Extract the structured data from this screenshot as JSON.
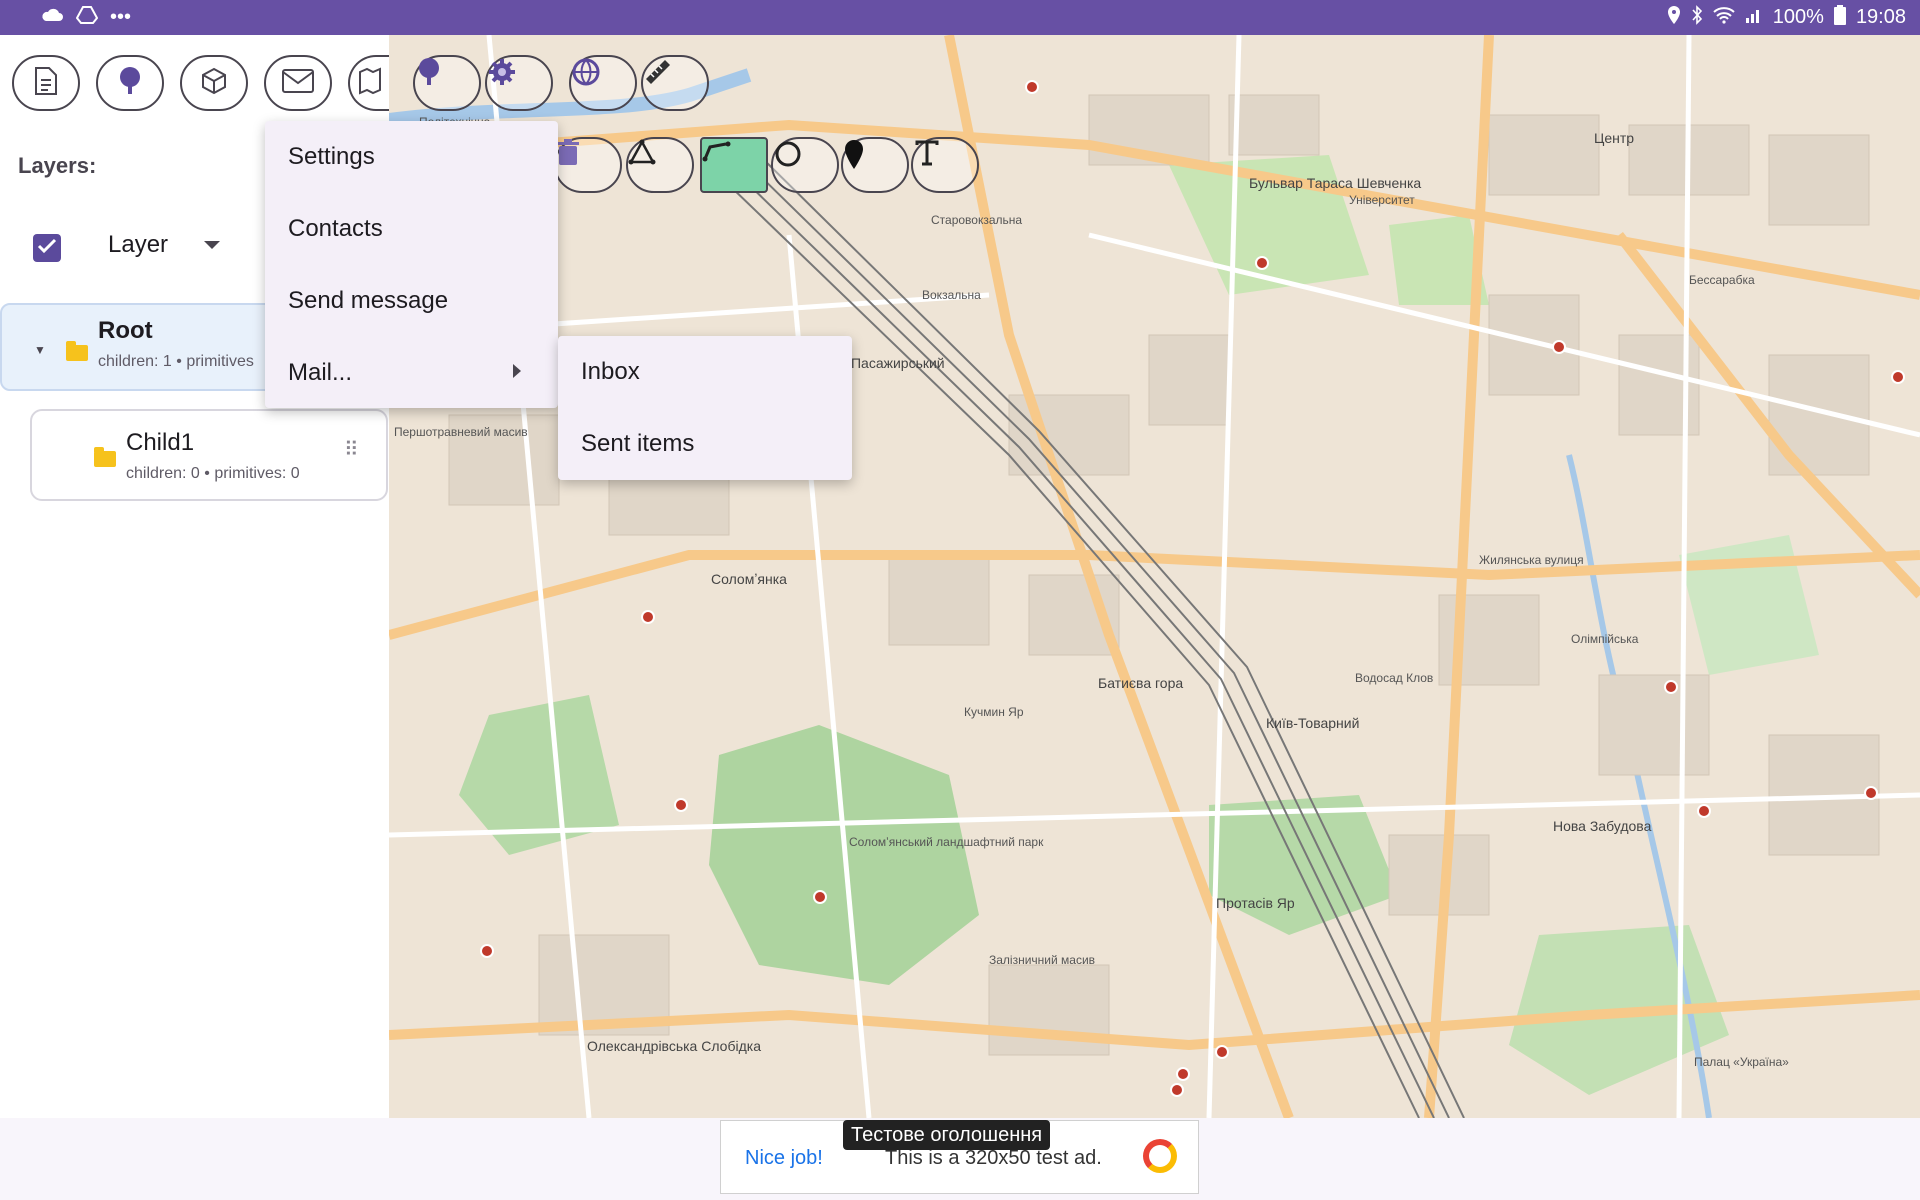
{
  "status_bar": {
    "left_icons": [
      "cloud-icon",
      "drive-icon",
      "more-icon"
    ],
    "battery": "100%",
    "time": "19:08",
    "more_glyph": "•••",
    "color": "#6750a4"
  },
  "panel": {
    "toolbar_icons": [
      "document-icon",
      "tree-icon",
      "cube-icon",
      "mail-icon",
      "map-pin-icon"
    ],
    "layers_title": "Layers:",
    "layer_checkbox_checked": true,
    "layer_select_value": "Layer",
    "tree": {
      "root": {
        "name": "Root",
        "sub": "children: 1 • primitives"
      },
      "child": {
        "name": "Child1",
        "sub": "children: 0 • primitives: 0"
      }
    }
  },
  "map_toolbar": {
    "top_icons": [
      "tree-icon",
      "settings-icon",
      "globe-icon",
      "ruler-icon"
    ],
    "draw_tools": [
      "trash-icon",
      "polygon-icon",
      "polyline-icon",
      "circle-icon",
      "marker-icon",
      "text-icon"
    ],
    "active_tool": "polyline-icon",
    "active_color": "#7dd3a8"
  },
  "menu": {
    "items": [
      "Settings",
      "Contacts",
      "Send message",
      "Mail..."
    ],
    "submenu": [
      "Inbox",
      "Sent items"
    ]
  },
  "map_labels": {
    "l1": "Бульвар Тараса Шевченка",
    "l2": "Центр",
    "l3": "Університет",
    "l4": "Вокзальна",
    "l5": "Київ-Пасажирський",
    "l6": "Соломʼянка",
    "l7": "Батиєва гора",
    "l8": "Жилянська вулиця",
    "l9": "Олімпійська",
    "l10": "Нова Забудова",
    "l11": "Протасів Яр",
    "l12": "Олександрівська Слобідка",
    "l13": "Київ-Товарний",
    "l14": "Водосад Клов",
    "l15": "Бессарабка",
    "l16": "Соломʼянський ландшафтний парк",
    "l17": "Палац «Україна»",
    "l18": "Кучмин Яр",
    "l19": "Залізничний масив",
    "l20": "Першотравневий масив",
    "l21": "Політехнічна",
    "l22": "Старовокзальна"
  },
  "ad": {
    "left_text": "Nice job!",
    "right_text": "This is a 320x50 test ad.",
    "badge": "Тестове оголошення"
  }
}
